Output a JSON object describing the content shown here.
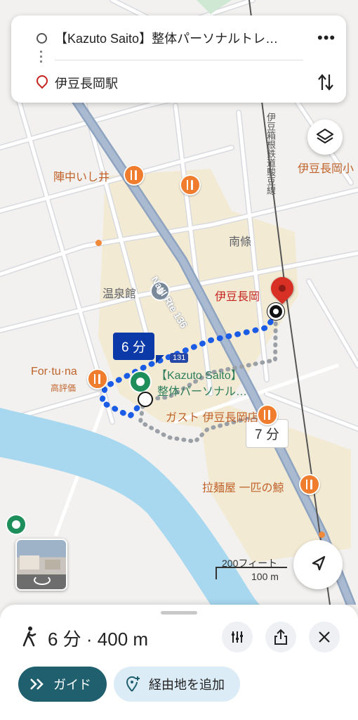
{
  "search": {
    "origin": "【Kazuto Saito】整体パーソナルトレ…",
    "destination": "伊豆長岡駅",
    "more_icon": "more-vert-icon",
    "swap_icon": "swap-icon"
  },
  "map": {
    "labels": {
      "jinnaka": "陣中いし井",
      "nanjo": "南條",
      "onsenkan": "温泉館",
      "izunagaoka": "伊豆長岡",
      "izunagaoka_edge": "伊豆長岡小",
      "fortuna": "For·tu·na",
      "fortuna_sub": "高評価",
      "kazuto_line1": "【Kazuto Saito】",
      "kazuto_line2": "整体パーソナル…",
      "gusto": "ガスト 伊豆長岡店",
      "ramen": "拉麺屋 一匹の鯨",
      "rail": "伊豆箱根鉄道駿豆線",
      "road": "Nat'l Rte 136",
      "route_shield": "131"
    },
    "route_time_selected": "6 分",
    "route_time_alt": "7 分",
    "scale": {
      "imperial": "200フィート",
      "metric": "100 m"
    }
  },
  "bottom": {
    "summary": "6 分 · 400 m",
    "guide_button": "ガイド",
    "waypoint_button": "経由地を追加"
  },
  "colors": {
    "route_blue": "#1a5ce6",
    "bubble_dark": "#0b3aa8",
    "pin_red": "#d93025",
    "food_orange": "#f07d2e",
    "guide_teal": "#1f5f6e",
    "water": "#a7d8ef"
  }
}
